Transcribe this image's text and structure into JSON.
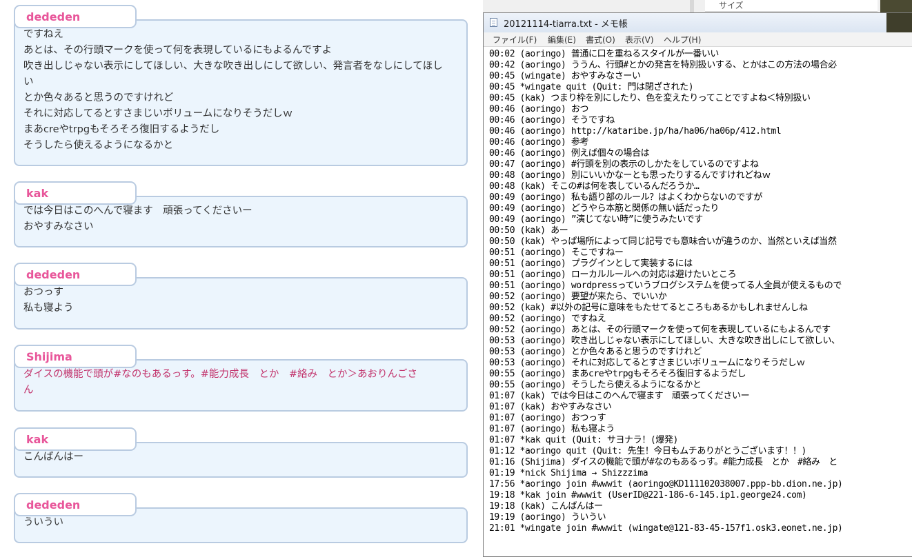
{
  "chat": {
    "messages": [
      {
        "author": "dededen",
        "lines": [
          "ですねえ",
          "あとは、その行頭マークを使って何を表現しているにもよるんですよ",
          "吹き出しじゃない表示にしてほしい、大きな吹き出しにして欲しい、発言者をなしにしてほし",
          "い",
          "とか色々あると思うのですけれど",
          "それに対応してるとすさまじいボリュームになりそうだしｗ",
          "まあcreやtrpgもそろそろ復旧するようだし",
          "そうしたら使えるようになるかと"
        ]
      },
      {
        "author": "kak",
        "lines": [
          "では今日はこのへんで寝ます　頑張ってくださいー",
          "おやすみなさい"
        ]
      },
      {
        "author": "dededen",
        "lines": [
          "おつっす",
          "私も寝よう"
        ]
      },
      {
        "author": "Shijima",
        "lines": [
          "ダイスの機能で頭が#なのもあるっす。#能力成長　とか　#絡み　とか＞あおりんごさ",
          "ん"
        ]
      },
      {
        "author": "kak",
        "lines": [
          "こんばんはー"
        ]
      },
      {
        "author": "dededen",
        "lines": [
          "ういうい"
        ]
      }
    ]
  },
  "background": {
    "size_label": "サイズ"
  },
  "notepad": {
    "title": "20121114-tiarra.txt - メモ帳",
    "menu": [
      "ファイル(F)",
      "編集(E)",
      "書式(O)",
      "表示(V)",
      "ヘルプ(H)"
    ],
    "log": [
      "00:02 (aoringo) 普通に口を重ねるスタイルが一番いい",
      "00:42 (aoringo) ううん、行頭#とかの発言を特別扱いする、とかはこの方法の場合必",
      "00:45 (wingate) おやすみなさーい",
      "00:45 *wingate quit (Quit: 門は閉ざされた)",
      "00:45 (kak) つまり枠を別にしたり、色を変えたりってことですよね＜特別扱い",
      "00:46 (aoringo) おつ",
      "00:46 (aoringo) そうですね",
      "00:46 (aoringo) http://kataribe.jp/ha/ha06/ha06p/412.html",
      "00:46 (aoringo) 参考",
      "00:46 (aoringo) 例えば個々の場合は",
      "00:47 (aoringo) #行頭を別の表示のしかたをしているのですよね",
      "00:48 (aoringo) 別にいいかなーとも思ったりするんですけれどねｗ",
      "00:48 (kak) そこの#は何を表しているんだろうか…",
      "00:49 (aoringo) 私も語り部のルール？はよくわからないのですが",
      "00:49 (aoringo) どうやら本筋と関係の無い話だったり",
      "00:49 (aoringo) ”演じてない時”に使うみたいです",
      "00:50 (kak) あー",
      "00:50 (kak) やっぱ場所によって同じ記号でも意味合いが違うのか、当然といえば当然",
      "00:51 (aoringo) そこですねー",
      "00:51 (aoringo) プラグインとして実装するには",
      "00:51 (aoringo) ローカルルールへの対応は避けたいところ",
      "00:51 (aoringo) wordpressっていうブログシステムを使ってる人全員が使えるもので",
      "00:52 (aoringo) 要望が来たら、でいいか",
      "00:52 (kak) #以外の記号に意味をもたせてるところもあるかもしれませんしね",
      "00:52 (aoringo) ですねえ",
      "00:52 (aoringo) あとは、その行頭マークを使って何を表現しているにもよるんです",
      "00:53 (aoringo) 吹き出しじゃない表示にしてほしい、大きな吹き出しにして欲しい、",
      "00:53 (aoringo) とか色々あると思うのですけれど",
      "00:53 (aoringo) それに対応してるとすさまじいボリュームになりそうだしｗ",
      "00:55 (aoringo) まあcreやtrpgもそろそろ復旧するようだし",
      "00:55 (aoringo) そうしたら使えるようになるかと",
      "01:07 (kak) では今日はこのへんで寝ます　頑張ってくださいー",
      "01:07 (kak) おやすみなさい",
      "01:07 (aoringo) おつっす",
      "01:07 (aoringo) 私も寝よう",
      "01:07 *kak quit (Quit: サヨナラ！(爆発)",
      "01:12 *aoringo quit (Quit: 先生！今日もムチありがとうございます！！)",
      "01:16 (Shijima) ダイスの機能で頭が#なのもあるっす。#能力成長　とか　#絡み　と",
      "01:19 *nick Shijima → Shizzzima",
      "17:56 *aoringo join #wwwit (aoringo@KD111102038007.ppp-bb.dion.ne.jp)",
      "19:18 *kak join #wwwit (UserID@221-186-6-145.ip1.george24.com)",
      "19:18 (kak) こんばんはー",
      "19:19 (aoringo) ういうい",
      "21:01 *wingate join #wwwit (wingate@121-83-45-157f1.osk3.eonet.ne.jp)"
    ]
  }
}
